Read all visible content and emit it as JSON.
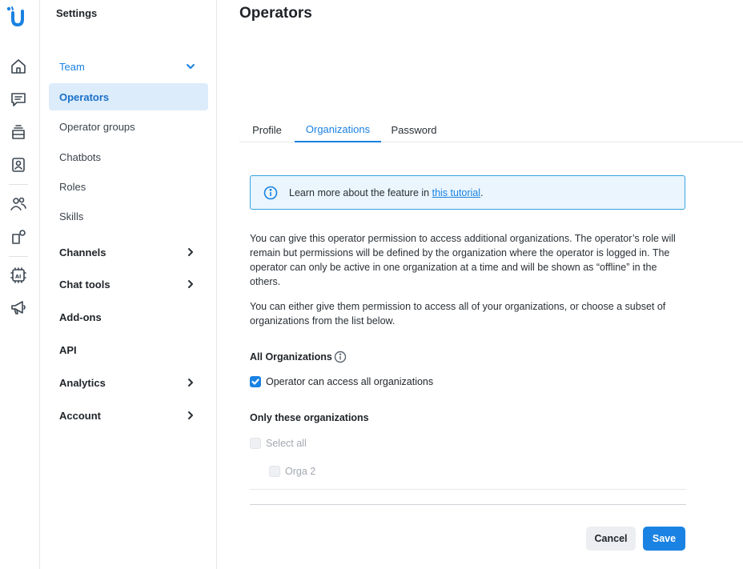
{
  "rail": {
    "icons": [
      "logo-icon",
      "home-icon",
      "chat-icon",
      "inbox-icon",
      "contacts-icon",
      "people-icon",
      "integrations-icon",
      "ai-icon",
      "megaphone-icon"
    ],
    "accent": "#1a82e2"
  },
  "sidebar": {
    "title": "Settings",
    "team": "Team",
    "operators": "Operators",
    "operator_groups": "Operator groups",
    "chatbots": "Chatbots",
    "roles": "Roles",
    "skills": "Skills",
    "channels": "Channels",
    "chat_tools": "Chat tools",
    "addons": "Add-ons",
    "api": "API",
    "analytics": "Analytics",
    "account": "Account"
  },
  "main": {
    "title": "Operators",
    "tabs": [
      "Profile",
      "Organizations",
      "Password"
    ],
    "active_tab": "Organizations",
    "info_prefix": "Learn more about the feature in ",
    "info_link": "this tutorial",
    "info_suffix": ".",
    "para1": "You can give this operator permission to access additional organizations. The operator’s role will remain but permissions will be defined by the organization where the operator is logged in. The operator can only be active in one organization at a time and will be shown as “offline” in the others.",
    "para2": "You can either give them permission to access all of your organizations, or choose a subset of organizations from the list below.",
    "all_orgs_label": "All Organizations",
    "all_orgs_checkbox": "Operator can access all organizations",
    "all_orgs_checked": true,
    "only_these_label": "Only these organizations",
    "select_all": "Select all",
    "orgs": [
      "Orga 2"
    ],
    "cancel": "Cancel",
    "save": "Save"
  },
  "colors": {
    "primary": "#1a82e2",
    "active_bg": "#dcecfb",
    "info_bg": "#eaf5fd"
  }
}
